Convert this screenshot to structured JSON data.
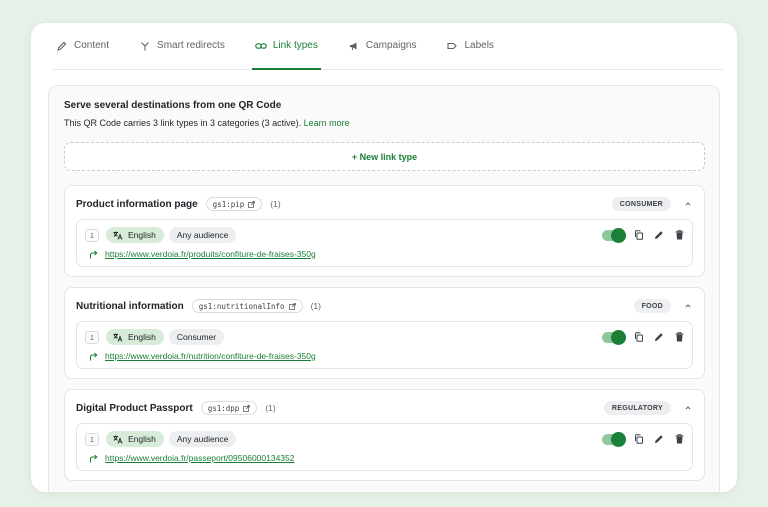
{
  "tabs": [
    {
      "label": "Content",
      "icon": "pencil-icon"
    },
    {
      "label": "Smart redirects",
      "icon": "split-arrow-icon"
    },
    {
      "label": "Link types",
      "icon": "link-icon",
      "active": true
    },
    {
      "label": "Campaigns",
      "icon": "megaphone-icon"
    },
    {
      "label": "Labels",
      "icon": "tag-icon"
    }
  ],
  "panel": {
    "title": "Serve several destinations from one QR Code",
    "subtitle": "This QR Code carries 3 link types in 3 categories (3 active).",
    "learn_more": "Learn more",
    "new_button": "+  New link type"
  },
  "groups": [
    {
      "title": "Product information page",
      "code": "gs1:pip",
      "count": "(1)",
      "category": "CONSUMER",
      "link": {
        "index": "1",
        "language": "English",
        "audience": "Any audience",
        "url": "https://www.verdoia.fr/produits/confiture-de-fraises-350g",
        "active": true
      }
    },
    {
      "title": "Nutritional information",
      "code": "gs1:nutritionalInfo",
      "count": "(1)",
      "category": "FOOD",
      "link": {
        "index": "1",
        "language": "English",
        "audience": "Consumer",
        "url": "https://www.verdoia.fr/nutrition/confiture-de-fraises-350g",
        "active": true
      }
    },
    {
      "title": "Digital Product Passport",
      "code": "gs1:dpp",
      "count": "(1)",
      "category": "REGULATORY",
      "link": {
        "index": "1",
        "language": "English",
        "audience": "Any audience",
        "url": "https://www.verdoia.fr/passeport/09506000134352",
        "active": true
      }
    }
  ],
  "colors": {
    "accent": "#1a7f37",
    "background": "#e6f2e8",
    "language_chip": "#d6ecd9"
  }
}
